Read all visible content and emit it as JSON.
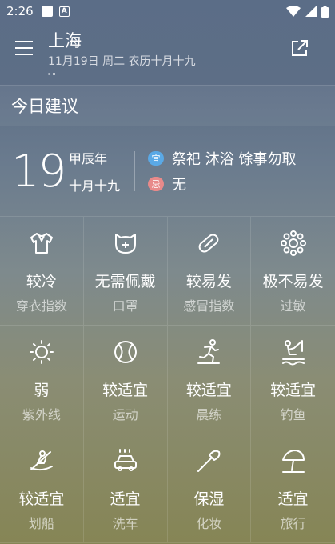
{
  "status": {
    "time": "2:26",
    "a_label": "A"
  },
  "header": {
    "city": "上海",
    "date": "11月19日 周二 农历十月十九"
  },
  "section_title": "今日建议",
  "almanac": {
    "day": "19",
    "ganzhi_year": "甲辰年",
    "lunar_date": "十月十九",
    "yi_label": "宜",
    "yi_text": "祭祀 沐浴 馀事勿取",
    "ji_label": "忌",
    "ji_text": "无",
    "yi_color": "#5aa9e6",
    "ji_color": "#e88a8a"
  },
  "indices": [
    {
      "icon": "shirt-icon",
      "value": "较冷",
      "label": "穿衣指数"
    },
    {
      "icon": "mask-icon",
      "value": "无需佩戴",
      "label": "口罩"
    },
    {
      "icon": "pill-icon",
      "value": "较易发",
      "label": "感冒指数"
    },
    {
      "icon": "pollen-icon",
      "value": "极不易发",
      "label": "过敏"
    },
    {
      "icon": "sun-icon",
      "value": "弱",
      "label": "紫外线"
    },
    {
      "icon": "ball-icon",
      "value": "较适宜",
      "label": "运动"
    },
    {
      "icon": "runner-icon",
      "value": "较适宜",
      "label": "晨练"
    },
    {
      "icon": "fishing-icon",
      "value": "较适宜",
      "label": "钓鱼"
    },
    {
      "icon": "rowing-icon",
      "value": "较适宜",
      "label": "划船"
    },
    {
      "icon": "car-wash-icon",
      "value": "适宜",
      "label": "洗车"
    },
    {
      "icon": "cosmetics-icon",
      "value": "保湿",
      "label": "化妆"
    },
    {
      "icon": "beach-umbrella-icon",
      "value": "适宜",
      "label": "旅行"
    }
  ]
}
